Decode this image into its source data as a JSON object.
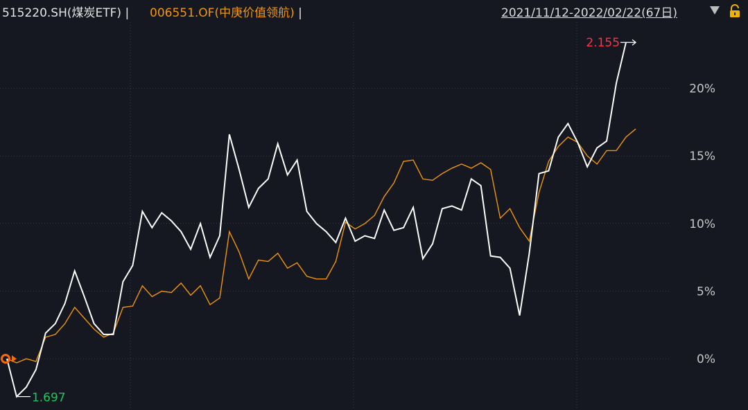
{
  "header": {
    "series1_label": "515220.SH(煤炭ETF)",
    "separator": "|",
    "series2_label": "006551.OF(中庚价值领航)",
    "date_range": "2021/11/12-2022/02/22(67日)"
  },
  "icons": {
    "dropdown": "caret-down-icon",
    "lock": "lock-icon"
  },
  "colors": {
    "background": "#151820",
    "grid": "#3a3f4a",
    "series1": "#ffffff",
    "series2": "#f2960a",
    "max_label": "#ff3344",
    "min_label": "#22c55e",
    "marker": "#ff6a00"
  },
  "chart_data": {
    "type": "line",
    "x_count": 57,
    "ylim": [
      -3.6,
      26.0
    ],
    "y_ticks": [
      0,
      5,
      10,
      15,
      20
    ],
    "y_tick_labels": [
      "0%",
      "5%",
      "10%",
      "15%",
      "20%"
    ],
    "grid": true,
    "series": [
      {
        "name": "515220.SH(煤炭ETF)",
        "values": [
          0.0,
          -2.8,
          -2.1,
          -0.8,
          1.9,
          2.6,
          4.1,
          6.5,
          4.6,
          2.6,
          1.8,
          1.8,
          5.7,
          6.9,
          10.9,
          9.7,
          10.8,
          10.2,
          9.4,
          8.1,
          10.0,
          7.5,
          9.1,
          16.6,
          14.0,
          11.2,
          12.6,
          13.3,
          15.9,
          13.6,
          14.7,
          10.9,
          10.0,
          9.4,
          8.6,
          10.4,
          8.7,
          9.1,
          8.9,
          11.0,
          9.5,
          9.7,
          11.2,
          7.4,
          8.5,
          11.1,
          11.3,
          11.0,
          13.3,
          12.8,
          7.6,
          7.5,
          6.7,
          3.2,
          7.8,
          13.7,
          13.9,
          16.4,
          17.4,
          16.0,
          14.2,
          15.6,
          16.1,
          20.4,
          23.4
        ]
      },
      {
        "name": "006551.OF(中庚价值领航)",
        "values": [
          0.0,
          -0.3,
          0.0,
          -0.2,
          1.6,
          1.8,
          2.6,
          3.8,
          3.0,
          2.2,
          1.6,
          1.9,
          3.8,
          3.9,
          5.4,
          4.6,
          5.0,
          4.9,
          5.6,
          4.7,
          5.4,
          4.0,
          4.5,
          9.4,
          7.9,
          5.9,
          7.3,
          7.2,
          7.8,
          6.7,
          7.1,
          6.1,
          5.9,
          5.9,
          7.2,
          10.1,
          9.6,
          10.0,
          10.6,
          12.0,
          13.0,
          14.6,
          14.7,
          13.3,
          13.2,
          13.7,
          14.1,
          14.4,
          14.1,
          14.5,
          14.0,
          10.4,
          11.1,
          9.7,
          8.7,
          12.3,
          14.6,
          15.7,
          16.4,
          16.0,
          15.0,
          14.4,
          15.4,
          15.4,
          16.4,
          17.0
        ]
      }
    ],
    "annotations": {
      "max_value_label": "2.155",
      "min_value_label": "1.697"
    }
  }
}
